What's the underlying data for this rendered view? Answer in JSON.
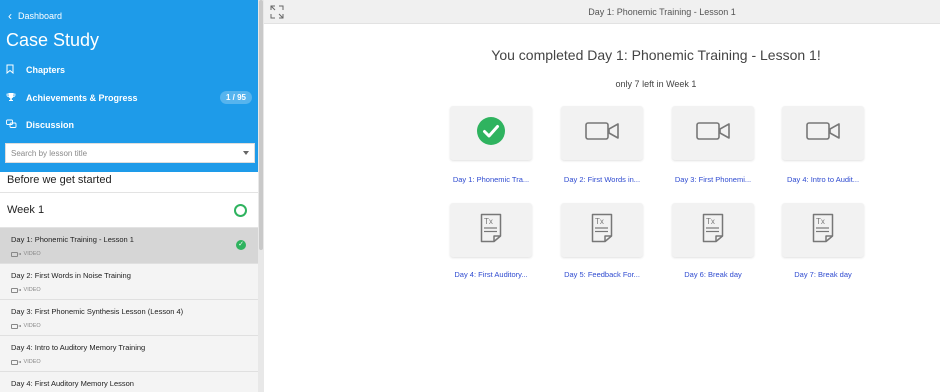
{
  "sidebar": {
    "back_label": "Dashboard",
    "course_title": "Case Study",
    "nav": {
      "chapters": "Chapters",
      "achievements": "Achievements & Progress",
      "achievements_badge": "1 / 95",
      "discussion": "Discussion"
    },
    "search_placeholder": "Search by lesson title",
    "sections": {
      "intro": "Before we get started",
      "week": "Week 1"
    },
    "lessons": [
      {
        "title": "Day 1: Phonemic Training - Lesson 1",
        "type": "VIDEO",
        "completed": true
      },
      {
        "title": "Day 2: First Words in Noise Training",
        "type": "VIDEO",
        "completed": false
      },
      {
        "title": "Day 3: First Phonemic Synthesis Lesson (Lesson 4)",
        "type": "VIDEO",
        "completed": false
      },
      {
        "title": "Day 4: Intro to Auditory Memory Training",
        "type": "VIDEO",
        "completed": false
      },
      {
        "title": "Day 4: First Auditory Memory Lesson",
        "type": "",
        "completed": false
      }
    ]
  },
  "topbar": {
    "title": "Day 1: Phonemic Training - Lesson 1"
  },
  "main": {
    "completed_title": "You completed Day 1: Phonemic Training - Lesson 1!",
    "remaining_text": "only 7 left in Week 1",
    "cards": [
      {
        "label": "Day 1: Phonemic Tra...",
        "icon": "check-icon"
      },
      {
        "label": "Day 2: First Words in...",
        "icon": "video-icon"
      },
      {
        "label": "Day 3: First Phonemi...",
        "icon": "video-icon"
      },
      {
        "label": "Day 4: Intro to Audit...",
        "icon": "video-icon"
      },
      {
        "label": "Day 4: First Auditory...",
        "icon": "document-icon"
      },
      {
        "label": "Day 5: Feedback For...",
        "icon": "document-icon"
      },
      {
        "label": "Day 6: Break day",
        "icon": "document-icon"
      },
      {
        "label": "Day 7: Break day",
        "icon": "document-icon"
      }
    ]
  },
  "colors": {
    "sidebar_blue": "#1e9be9",
    "success_green": "#2fb35f",
    "link_blue": "#2f4bd0"
  }
}
